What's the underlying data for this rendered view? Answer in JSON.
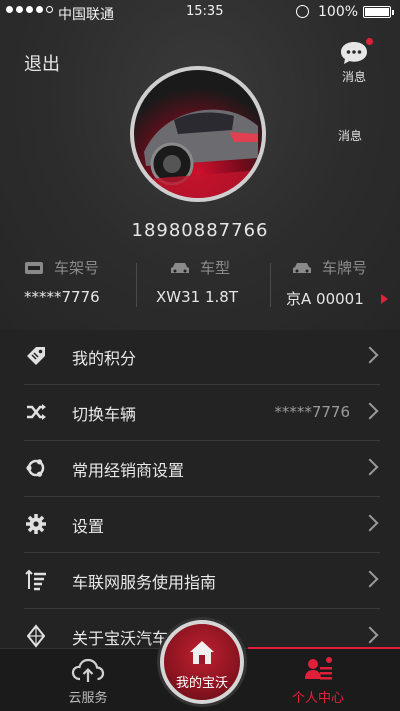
{
  "status": {
    "carrier": "中国联通",
    "time": "15:35",
    "battery": "100%",
    "signal_bars_filled": 4,
    "signal_bars_total": 5
  },
  "header": {
    "logout_label": "退出",
    "message_label": "消息",
    "message_label_2": "消息"
  },
  "profile": {
    "phone": "18980887766"
  },
  "vehicle": {
    "frame_label": "车架号",
    "frame_value": "*****7776",
    "model_label": "车型",
    "model_value": "XW31 1.8T",
    "plate_label": "车牌号",
    "plate_value": "京A 00001"
  },
  "menu": [
    {
      "label": "我的积分",
      "value": "",
      "icon": "tag-icon"
    },
    {
      "label": "切换车辆",
      "value": "*****7776",
      "icon": "shuffle-icon"
    },
    {
      "label": "常用经销商设置",
      "value": "",
      "icon": "ubuntu-icon"
    },
    {
      "label": "设置",
      "value": "",
      "icon": "gear-icon"
    },
    {
      "label": "车联网服务使用指南",
      "value": "",
      "icon": "list-icon"
    },
    {
      "label": "关于宝沃汽车",
      "value": "",
      "icon": "diamond-icon"
    }
  ],
  "tabs": {
    "cloud": "云服务",
    "center": "我的宝沃",
    "me": "个人中心"
  },
  "colors": {
    "accent": "#e0203a",
    "background": "#232323"
  }
}
